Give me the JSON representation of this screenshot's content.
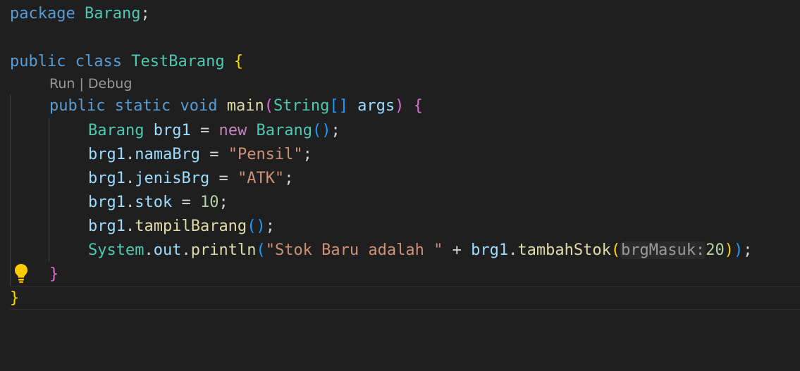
{
  "codelens": {
    "run": "Run",
    "separator": " | ",
    "debug": "Debug"
  },
  "code": {
    "l1": {
      "kw": "package",
      "name": "Barang",
      "semi": ";"
    },
    "l3": {
      "kw1": "public",
      "kw2": "class",
      "name": "TestBarang",
      "brace": "{"
    },
    "l4": {
      "kw1": "public",
      "kw2": "static",
      "kw3": "void",
      "fn": "main",
      "lp": "(",
      "type": "String",
      "br": "[]",
      "param": "args",
      "rp": ")",
      "brace": "{"
    },
    "l5": {
      "type": "Barang",
      "var": "brg1",
      "eq": " = ",
      "kw": "new",
      "ctor": "Barang",
      "parens": "()",
      "semi": ";"
    },
    "l6": {
      "obj": "brg1",
      "dot": ".",
      "field": "namaBrg",
      "eq": " = ",
      "str": "\"Pensil\"",
      "semi": ";"
    },
    "l7": {
      "obj": "brg1",
      "dot": ".",
      "field": "jenisBrg",
      "eq": " = ",
      "str": "\"ATK\"",
      "semi": ";"
    },
    "l8": {
      "obj": "brg1",
      "dot": ".",
      "field": "stok",
      "eq": " = ",
      "num": "10",
      "semi": ";"
    },
    "l9": {
      "obj": "brg1",
      "dot": ".",
      "fn": "tampilBarang",
      "parens": "()",
      "semi": ";"
    },
    "l10": {
      "cls": "System",
      "dot1": ".",
      "field": "out",
      "dot2": ".",
      "fn": "println",
      "lp": "(",
      "str": "\"Stok Baru adalah \"",
      "plus": " + ",
      "obj": "brg1",
      "dot3": ".",
      "fn2": "tambahStok",
      "lp2": "(",
      "hint": "brgMasuk:",
      "num": "20",
      "rp2": ")",
      "rp": ")",
      "semi": ";"
    },
    "l11": {
      "brace": "}"
    },
    "l12": {
      "brace": "}"
    }
  },
  "colors": {
    "background": "#1f1f1f",
    "keyword": "#569cd6",
    "control_keyword": "#c586c0",
    "type": "#4ec9b0",
    "function": "#dcdcaa",
    "variable": "#9cdcfe",
    "string": "#ce9178",
    "number": "#b5cea8",
    "bracket_level1": "#ffd700",
    "bracket_level2": "#da70d6",
    "bracket_level3": "#179fff",
    "lightbulb": "#ffcc00"
  },
  "icons": {
    "lightbulb": "lightbulb-icon"
  }
}
